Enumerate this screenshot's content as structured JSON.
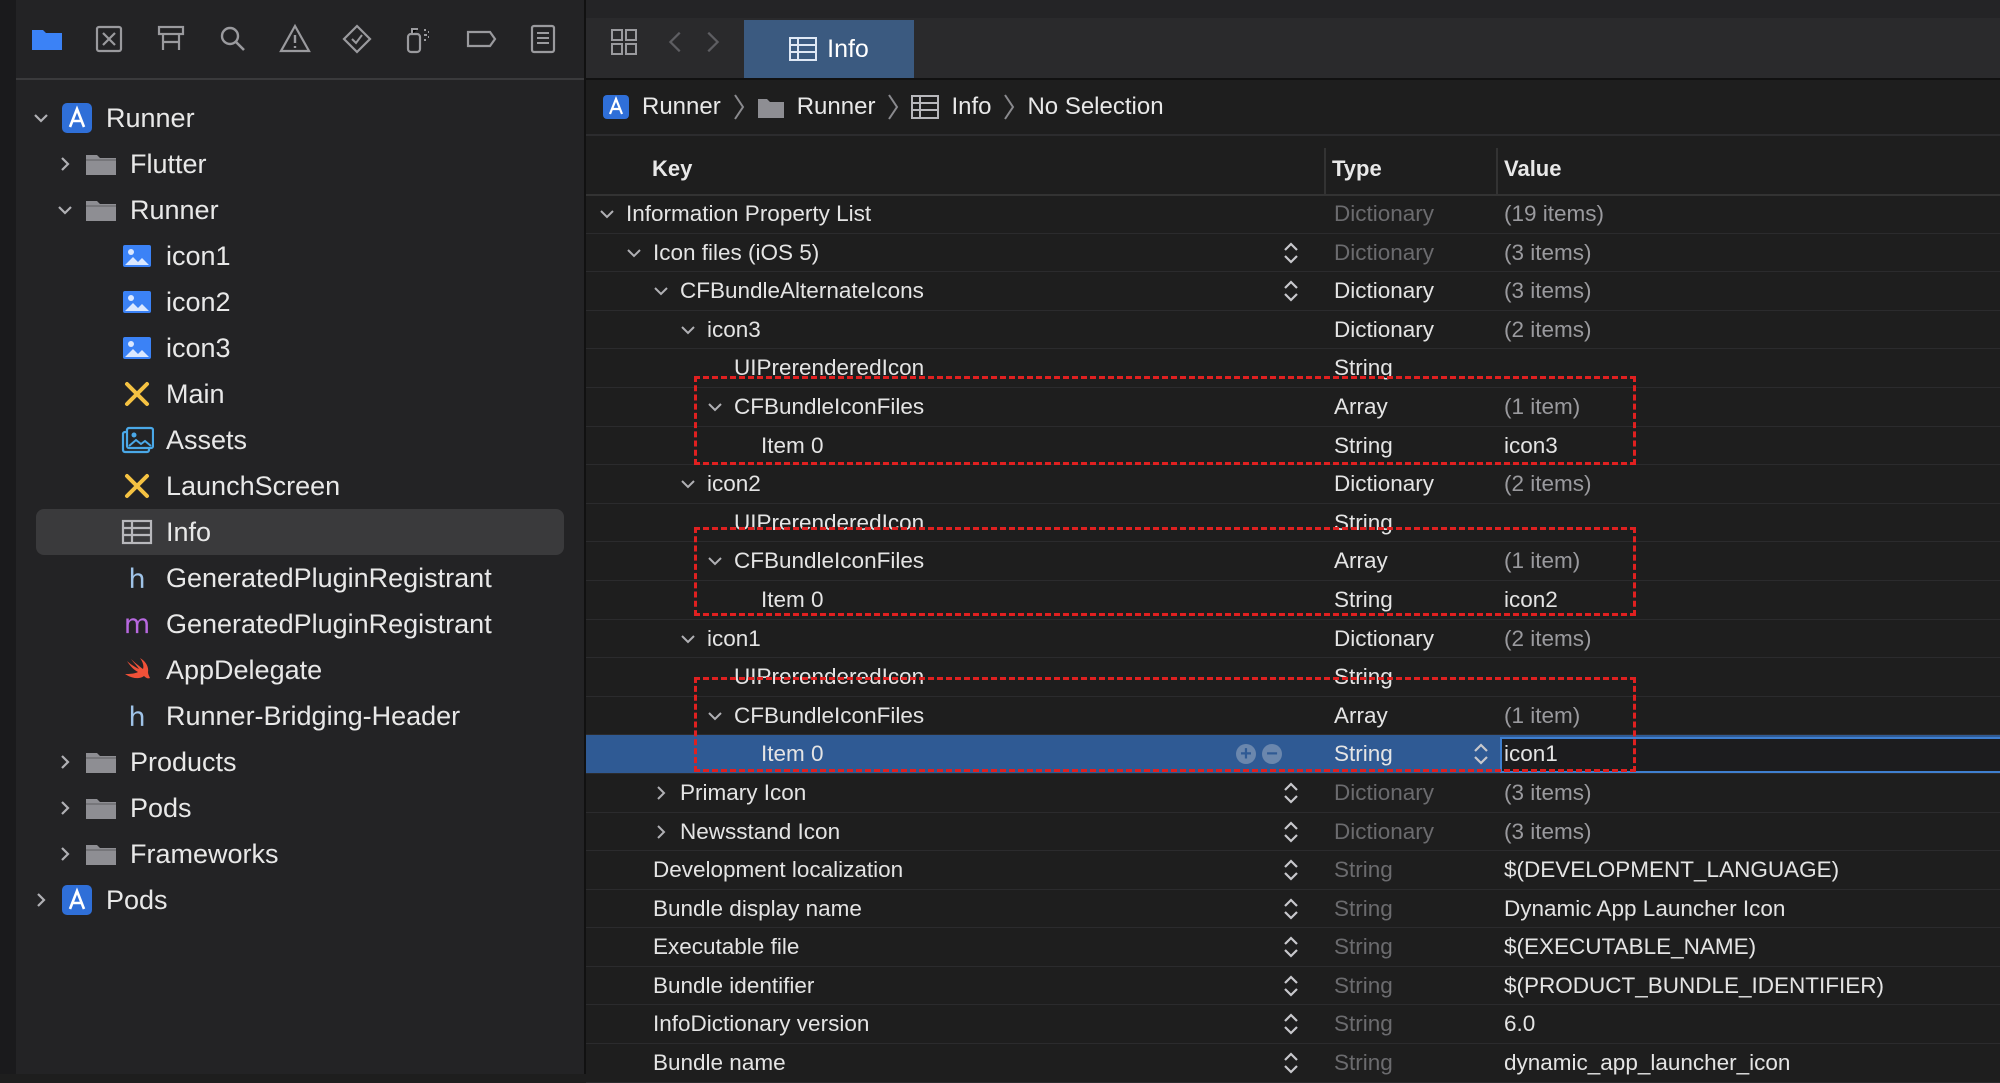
{
  "sidebar": {
    "tree": [
      {
        "label": "Runner",
        "icon": "xcode-project-icon",
        "chevron": "expanded",
        "indent": 0
      },
      {
        "label": "Flutter",
        "icon": "folder-icon",
        "chevron": "collapsed",
        "indent": 1
      },
      {
        "label": "Runner",
        "icon": "folder-icon",
        "chevron": "expanded",
        "indent": 1
      },
      {
        "label": "icon1",
        "icon": "image-file-icon",
        "chevron": "none",
        "indent": 2
      },
      {
        "label": "icon2",
        "icon": "image-file-icon",
        "chevron": "none",
        "indent": 2
      },
      {
        "label": "icon3",
        "icon": "image-file-icon",
        "chevron": "none",
        "indent": 2
      },
      {
        "label": "Main",
        "icon": "storyboard-icon",
        "chevron": "none",
        "indent": 2
      },
      {
        "label": "Assets",
        "icon": "asset-catalog-icon",
        "chevron": "none",
        "indent": 2
      },
      {
        "label": "LaunchScreen",
        "icon": "storyboard-icon",
        "chevron": "none",
        "indent": 2
      },
      {
        "label": "Info",
        "icon": "plist-icon",
        "chevron": "none",
        "indent": 2,
        "selected": true
      },
      {
        "label": "GeneratedPluginRegistrant",
        "icon": "header-file-icon",
        "chevron": "none",
        "indent": 2
      },
      {
        "label": "GeneratedPluginRegistrant",
        "icon": "objc-file-icon",
        "chevron": "none",
        "indent": 2
      },
      {
        "label": "AppDelegate",
        "icon": "swift-file-icon",
        "chevron": "none",
        "indent": 2
      },
      {
        "label": "Runner-Bridging-Header",
        "icon": "header-file-icon",
        "chevron": "none",
        "indent": 2
      },
      {
        "label": "Products",
        "icon": "folder-icon",
        "chevron": "collapsed",
        "indent": 1
      },
      {
        "label": "Pods",
        "icon": "folder-icon",
        "chevron": "collapsed",
        "indent": 1
      },
      {
        "label": "Frameworks",
        "icon": "folder-icon",
        "chevron": "collapsed",
        "indent": 1
      },
      {
        "label": "Pods",
        "icon": "xcode-project-icon",
        "chevron": "collapsed",
        "indent": 0
      }
    ],
    "header_glyph": "h",
    "objc_glyph": "m"
  },
  "editor": {
    "tab_label": "Info",
    "jumpbar": {
      "items": [
        "Runner",
        "Runner",
        "Info",
        "No Selection"
      ]
    },
    "columns": {
      "key": "Key",
      "type": "Type",
      "value": "Value"
    },
    "rows": [
      {
        "key": "Information Property List",
        "type": "Dictionary",
        "value": "(19 items)",
        "level": 0,
        "tri": "open",
        "type_dim": true,
        "value_dim": true,
        "stepper": false
      },
      {
        "key": "Icon files (iOS 5)",
        "type": "Dictionary",
        "value": "(3 items)",
        "level": 1,
        "tri": "open",
        "type_dim": true,
        "value_dim": true,
        "stepper": true
      },
      {
        "key": "CFBundleAlternateIcons",
        "type": "Dictionary",
        "value": "(3 items)",
        "level": 2,
        "tri": "open",
        "type_dim": false,
        "value_dim": true,
        "stepper": true
      },
      {
        "key": "icon3",
        "type": "Dictionary",
        "value": "(2 items)",
        "level": 3,
        "tri": "open",
        "type_dim": false,
        "value_dim": true,
        "stepper": false
      },
      {
        "key": "UIPrerenderedIcon",
        "type": "String",
        "value": "",
        "level": 4,
        "tri": "none",
        "type_dim": false,
        "value_dim": false,
        "stepper": false
      },
      {
        "key": "CFBundleIconFiles",
        "type": "Array",
        "value": "(1 item)",
        "level": 4,
        "tri": "open",
        "type_dim": false,
        "value_dim": true,
        "stepper": false
      },
      {
        "key": "Item 0",
        "type": "String",
        "value": "icon3",
        "level": 5,
        "tri": "none",
        "type_dim": false,
        "value_dim": false,
        "stepper": false
      },
      {
        "key": "icon2",
        "type": "Dictionary",
        "value": "(2 items)",
        "level": 3,
        "tri": "open",
        "type_dim": false,
        "value_dim": true,
        "stepper": false
      },
      {
        "key": "UIPrerenderedIcon",
        "type": "String",
        "value": "",
        "level": 4,
        "tri": "none",
        "type_dim": false,
        "value_dim": false,
        "stepper": false
      },
      {
        "key": "CFBundleIconFiles",
        "type": "Array",
        "value": "(1 item)",
        "level": 4,
        "tri": "open",
        "type_dim": false,
        "value_dim": true,
        "stepper": false
      },
      {
        "key": "Item 0",
        "type": "String",
        "value": "icon2",
        "level": 5,
        "tri": "none",
        "type_dim": false,
        "value_dim": false,
        "stepper": false
      },
      {
        "key": "icon1",
        "type": "Dictionary",
        "value": "(2 items)",
        "level": 3,
        "tri": "open",
        "type_dim": false,
        "value_dim": true,
        "stepper": false
      },
      {
        "key": "UIPrerenderedIcon",
        "type": "String",
        "value": "",
        "level": 4,
        "tri": "none",
        "type_dim": false,
        "value_dim": false,
        "stepper": false
      },
      {
        "key": "CFBundleIconFiles",
        "type": "Array",
        "value": "(1 item)",
        "level": 4,
        "tri": "open",
        "type_dim": false,
        "value_dim": true,
        "stepper": false
      },
      {
        "key": "Item 0",
        "type": "String",
        "value": "icon1",
        "level": 5,
        "tri": "none",
        "type_dim": false,
        "value_dim": false,
        "stepper": false,
        "selected": true
      },
      {
        "key": "Primary Icon",
        "type": "Dictionary",
        "value": "(3 items)",
        "level": 2,
        "tri": "closed",
        "type_dim": true,
        "value_dim": true,
        "stepper": true
      },
      {
        "key": "Newsstand Icon",
        "type": "Dictionary",
        "value": "(3 items)",
        "level": 2,
        "tri": "closed",
        "type_dim": true,
        "value_dim": true,
        "stepper": true
      },
      {
        "key": "Development localization",
        "type": "String",
        "value": "$(DEVELOPMENT_LANGUAGE)",
        "level": 1,
        "tri": "none",
        "type_dim": true,
        "value_dim": false,
        "stepper": true
      },
      {
        "key": "Bundle display name",
        "type": "String",
        "value": "Dynamic App Launcher Icon",
        "level": 1,
        "tri": "none",
        "type_dim": true,
        "value_dim": false,
        "stepper": true
      },
      {
        "key": "Executable file",
        "type": "String",
        "value": "$(EXECUTABLE_NAME)",
        "level": 1,
        "tri": "none",
        "type_dim": true,
        "value_dim": false,
        "stepper": true
      },
      {
        "key": "Bundle identifier",
        "type": "String",
        "value": "$(PRODUCT_BUNDLE_IDENTIFIER)",
        "level": 1,
        "tri": "none",
        "type_dim": true,
        "value_dim": false,
        "stepper": true
      },
      {
        "key": "InfoDictionary version",
        "type": "String",
        "value": "6.0",
        "level": 1,
        "tri": "none",
        "type_dim": true,
        "value_dim": false,
        "stepper": true
      },
      {
        "key": "Bundle name",
        "type": "String",
        "value": "dynamic_app_launcher_icon",
        "level": 1,
        "tri": "none",
        "type_dim": true,
        "value_dim": false,
        "stepper": true
      }
    ]
  },
  "colors": {
    "accent": "#3b82f6",
    "selection": "#2f5a94",
    "highlight_box": "#e02020",
    "folder": "#8e8e93",
    "swift": "#f05138",
    "storyboard": "#f5c242",
    "objc": "#b868e0"
  }
}
